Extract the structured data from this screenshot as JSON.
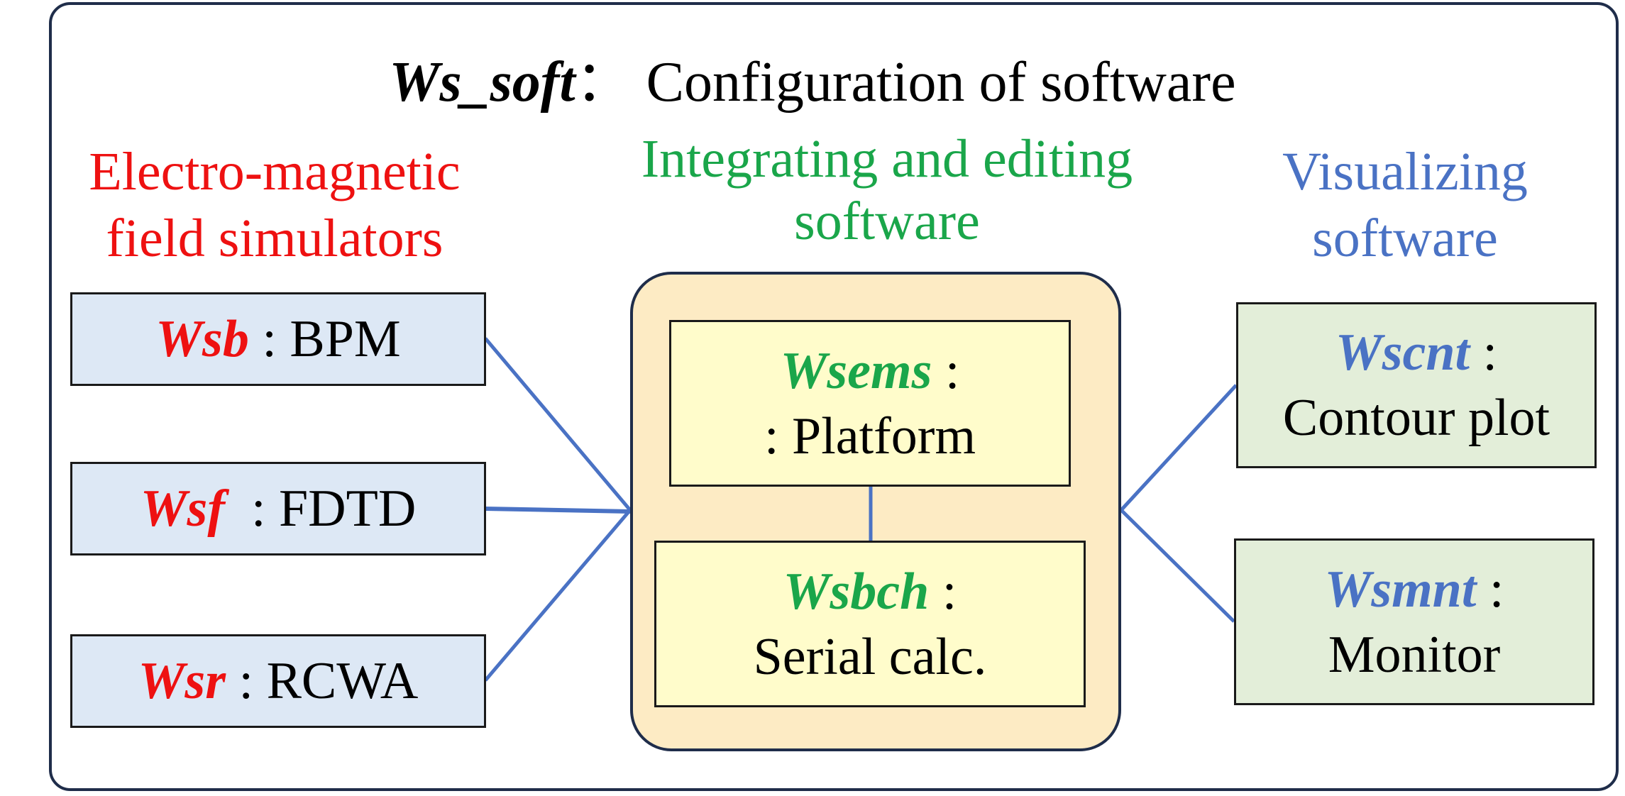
{
  "title": {
    "code": "Ws_soft",
    "separator": "：",
    "text": "Configuration of software"
  },
  "colors": {
    "simulators": "#ee1111",
    "integrating": "#1aa64a",
    "visualizing": "#4a72c4",
    "connector": "#4a72c4"
  },
  "columns": {
    "simulators": {
      "header_line1": "Electro-magnetic",
      "header_line2": "field simulators",
      "items": [
        {
          "code": "Wsb",
          "sep": " : ",
          "label": "BPM"
        },
        {
          "code": "Wsf",
          "sep": "  : ",
          "label": "FDTD"
        },
        {
          "code": "Wsr",
          "sep": " : ",
          "label": "RCWA"
        }
      ]
    },
    "integrating": {
      "header_line1": "Integrating and editing",
      "header_line2": "software",
      "items": [
        {
          "code": "Wsems",
          "sep": " :",
          "label": ": Platform"
        },
        {
          "code": "Wsbch",
          "sep": " :",
          "label": "Serial calc."
        }
      ]
    },
    "visualizing": {
      "header_line1": "Visualizing",
      "header_line2": "software",
      "items": [
        {
          "code": "Wscnt",
          "sep": " :",
          "label": "Contour plot"
        },
        {
          "code": "Wsmnt",
          "sep": " :",
          "label": "Monitor"
        }
      ]
    }
  }
}
